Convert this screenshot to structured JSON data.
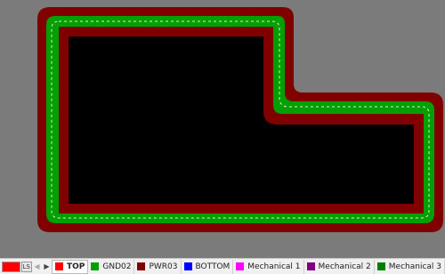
{
  "layer_controls": {
    "current_layer_color": "#ff0000",
    "ls_label": "LS",
    "prev_icon": "chevron-left-icon",
    "next_icon": "chevron-right-icon"
  },
  "layers": [
    {
      "label": "TOP",
      "color": "#ff0000",
      "active": true
    },
    {
      "label": "GND02",
      "color": "#00a000",
      "active": false
    },
    {
      "label": "PWR03",
      "color": "#800000",
      "active": false
    },
    {
      "label": "BOTTOM",
      "color": "#0000ff",
      "active": false
    },
    {
      "label": "Mechanical 1",
      "color": "#ff00ff",
      "active": false
    },
    {
      "label": "Mechanical 2",
      "color": "#800080",
      "active": false
    },
    {
      "label": "Mechanical 3",
      "color": "#008000",
      "active": false
    }
  ],
  "board": {
    "background": "#7b7b7b",
    "pwr_plane_color": "#800000",
    "gnd_plane_color": "#00a000",
    "fill_color": "#000000",
    "outline_color": "#e8e8e8"
  }
}
